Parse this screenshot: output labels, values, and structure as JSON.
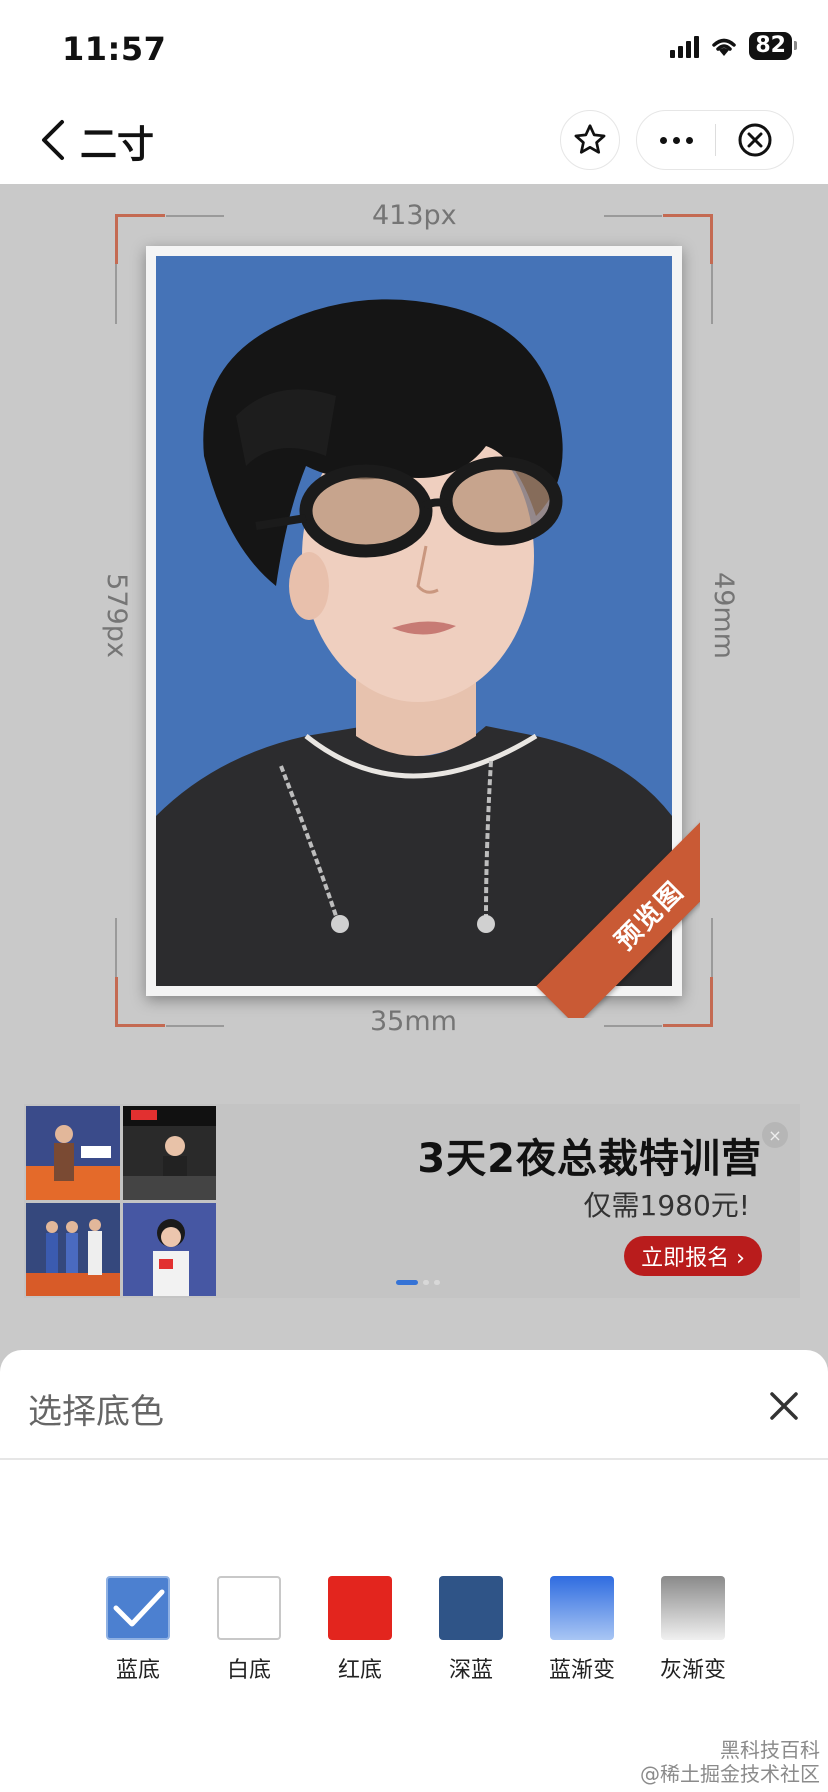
{
  "status_bar": {
    "time": "11:57",
    "battery": "82"
  },
  "nav": {
    "title": "二寸"
  },
  "preview": {
    "width_px": "413px",
    "height_px": "579px",
    "width_mm": "35mm",
    "height_mm": "49mm",
    "badge": "预览图",
    "background_color": "#4573b7"
  },
  "ad": {
    "title": "3天2夜总裁特训营",
    "subtitle": "仅需1980元!",
    "button": "立即报名 ›",
    "close": "×"
  },
  "sheet": {
    "title": "选择底色",
    "swatches": [
      {
        "label": "蓝底",
        "color": "#4c80d0",
        "selected": true
      },
      {
        "label": "白底",
        "color": "#ffffff",
        "selected": false
      },
      {
        "label": "红底",
        "color": "#e3251e",
        "selected": false
      },
      {
        "label": "深蓝",
        "color": "#2f5487",
        "selected": false
      },
      {
        "label": "蓝渐变",
        "color": "#3d7ae4",
        "selected": false
      },
      {
        "label": "灰渐变",
        "color": "#8a8a8a",
        "selected": false
      }
    ]
  },
  "watermark": {
    "line1": "黑科技百科",
    "line2": "@稀土掘金技术社区"
  }
}
